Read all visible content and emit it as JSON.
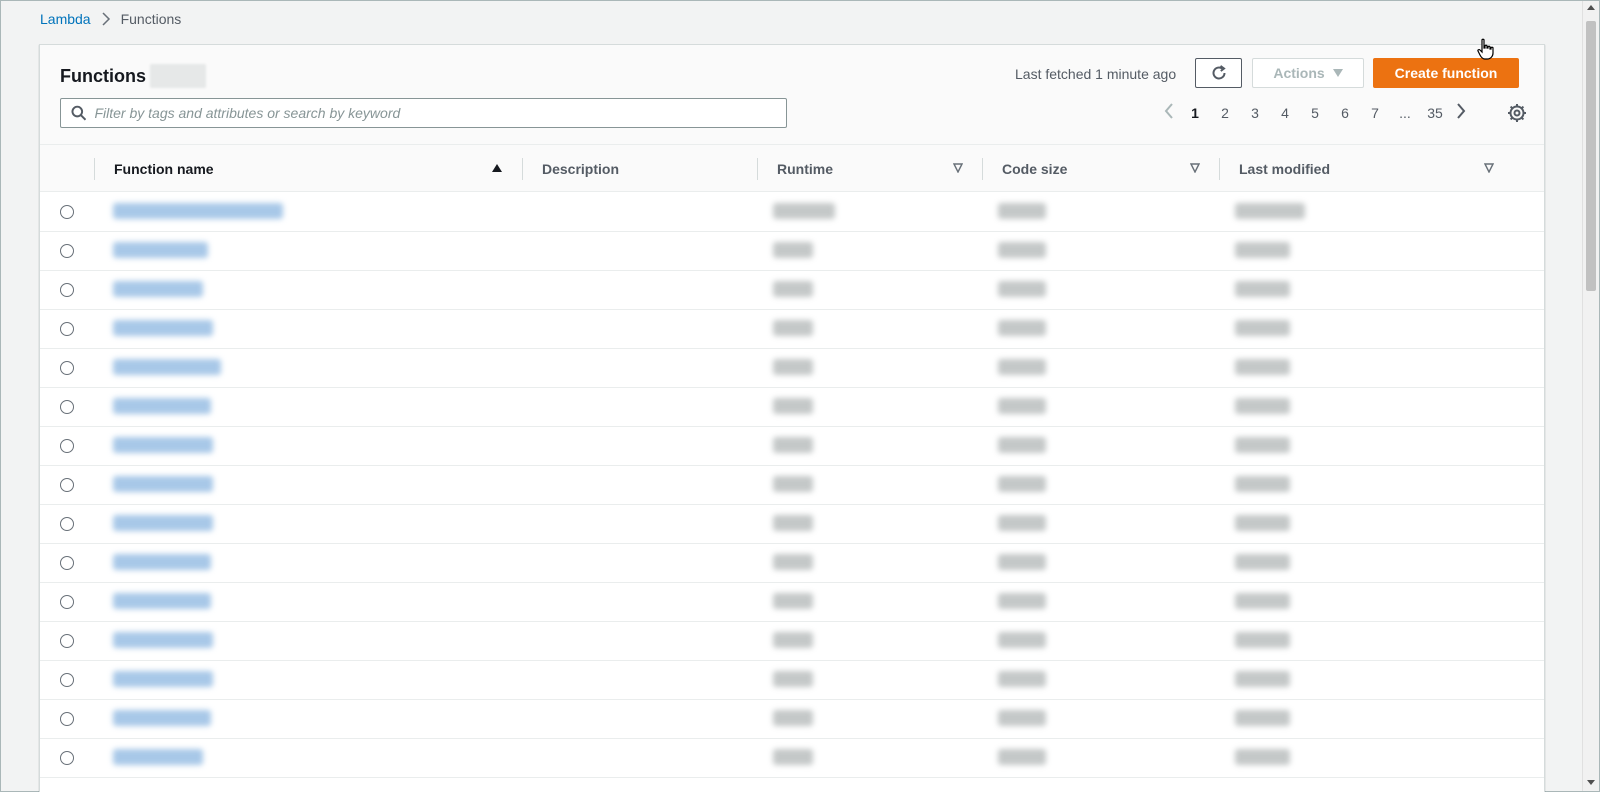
{
  "breadcrumb": {
    "root": "Lambda",
    "current": "Functions"
  },
  "panel": {
    "title": "Functions",
    "last_fetched": "Last fetched 1 minute ago",
    "actions_label": "Actions",
    "create_label": "Create function",
    "search_placeholder": "Filter by tags and attributes or search by keyword"
  },
  "pagination": {
    "pages": [
      "1",
      "2",
      "3",
      "4",
      "5",
      "6",
      "7",
      "...",
      "35"
    ],
    "current": "1"
  },
  "columns": {
    "name": "Function name",
    "description": "Description",
    "runtime": "Runtime",
    "code_size": "Code size",
    "last_modified": "Last modified"
  },
  "rows_visible": 15,
  "colors": {
    "accent": "#ec7211",
    "link": "#0073bb"
  },
  "icons": [
    "search-icon",
    "refresh-icon",
    "caret-down-icon",
    "chevron-left-icon",
    "chevron-right-icon",
    "gear-icon",
    "sort-ascending-icon",
    "sort-icon"
  ]
}
